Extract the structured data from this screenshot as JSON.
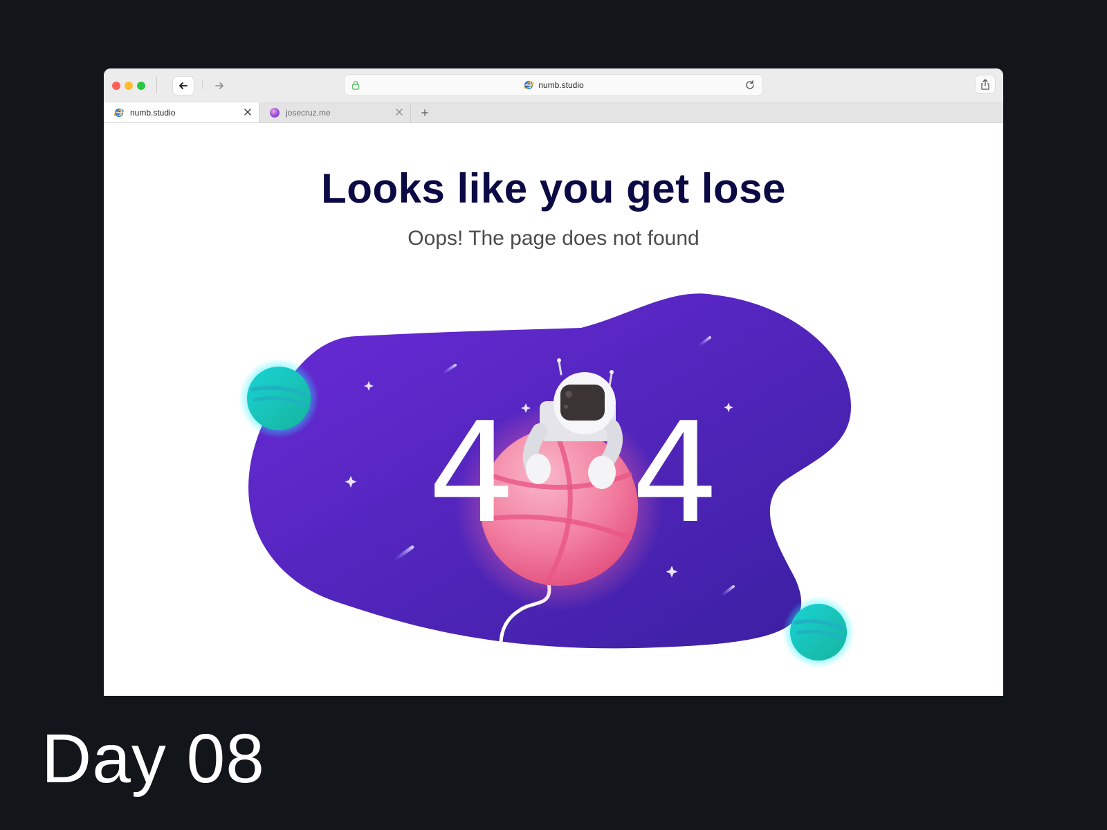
{
  "browser": {
    "address": {
      "domain": "numb.studio"
    },
    "tabs": [
      {
        "label": "numb.studio",
        "active": true
      },
      {
        "label": "josecruz.me",
        "active": false
      }
    ]
  },
  "page": {
    "headline": "Looks like you get lose",
    "subline": "Oops! The page does not found",
    "error_code": {
      "left": "4",
      "right": "4"
    }
  },
  "caption": "Day 08",
  "colors": {
    "background": "#121519",
    "headline": "#0b0a45",
    "blob_start": "#6a2bd8",
    "blob_end": "#3a1fa0",
    "planet_pink": "#f06a93",
    "planet_teal": "#13c9c0"
  }
}
